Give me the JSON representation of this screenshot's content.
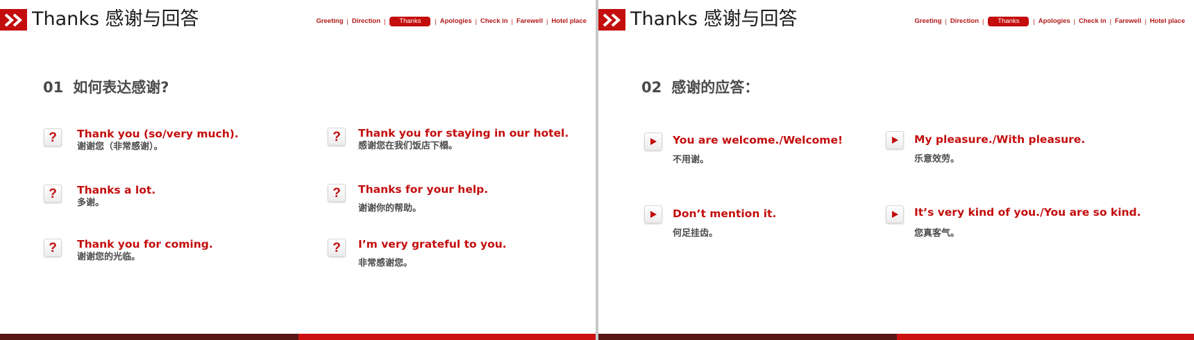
{
  "slides": [
    {
      "title": "Thanks 感谢与回答",
      "nav": [
        "Greeting",
        "Direction",
        "Thanks",
        "Apologies",
        "Check in",
        "Farewell",
        "Hotel place"
      ],
      "active_nav": "Thanks",
      "section_number": "01",
      "section_title": "如何表达感谢?",
      "phrases": [
        {
          "en": "Thank you (so/very much).",
          "zh": "谢谢您（非常感谢）。"
        },
        {
          "en": "Thank you for staying in our hotel.",
          "zh": "感谢您在我们饭店下榻。"
        },
        {
          "en": "Thanks a lot.",
          "zh": "多谢。"
        },
        {
          "en": "Thanks for your help.",
          "zh": "谢谢你的帮助。"
        },
        {
          "en": "Thank you for coming.",
          "zh": "谢谢您的光临。"
        },
        {
          "en": "I’m very grateful to you.",
          "zh": "非常感谢您。"
        }
      ],
      "icon_glyph": "?"
    },
    {
      "title": "Thanks 感谢与回答",
      "nav": [
        "Greeting",
        "Direction",
        "Thanks",
        "Apologies",
        "Check in",
        "Farewell",
        "Hotel place"
      ],
      "active_nav": "Thanks",
      "section_number": "02",
      "section_title": "感谢的应答：",
      "phrases": [
        {
          "en": "You are welcome./Welcome!",
          "zh": "不用谢。"
        },
        {
          "en": "My pleasure./With pleasure.",
          "zh": "乐意效劳。"
        },
        {
          "en": "Don’t mention it.",
          "zh": "何足挂齿。"
        },
        {
          "en": "It’s very kind of you./You are so kind.",
          "zh": "您真客气。"
        }
      ]
    }
  ],
  "colors": {
    "accent": "#c40d0d",
    "text_gray": "#4a4a4a",
    "bar_dark": "#5a1515",
    "bar_red": "#cc1111"
  },
  "icons": {
    "logo": "double-chevron-right-icon",
    "slide1_marker": "question-mark-icon",
    "slide2_marker": "play-triangle-icon"
  }
}
